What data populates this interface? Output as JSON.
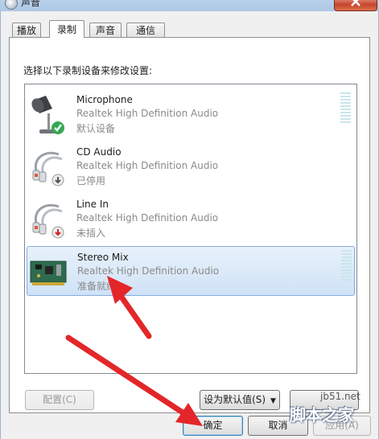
{
  "window": {
    "title": "声音",
    "icon": "speaker-icon",
    "close_icon": "close-icon"
  },
  "tabs": [
    {
      "label": "播放",
      "active": false
    },
    {
      "label": "录制",
      "active": true
    },
    {
      "label": "声音",
      "active": false
    },
    {
      "label": "通信",
      "active": false
    }
  ],
  "instruction": "选择以下录制设备来修改设置:",
  "devices": [
    {
      "name": "Microphone",
      "driver": "Realtek High Definition Audio",
      "status": "默认设备",
      "icon": "microphone-icon",
      "badge": "green-check-icon",
      "selected": false
    },
    {
      "name": "CD Audio",
      "driver": "Realtek High Definition Audio",
      "status": "已停用",
      "icon": "audio-cable-icon",
      "badge": "grey-down-arrow-icon",
      "selected": false
    },
    {
      "name": "Line In",
      "driver": "Realtek High Definition Audio",
      "status": "未插入",
      "icon": "audio-cable-icon",
      "badge": "red-down-arrow-icon",
      "selected": false
    },
    {
      "name": "Stereo Mix",
      "driver": "Realtek High Definition Audio",
      "status": "准备就绪",
      "icon": "sound-card-icon",
      "badge": "",
      "selected": true
    }
  ],
  "buttons": {
    "configure": "配置(C)",
    "set_default": "设为默认值(S)",
    "ok": "确定",
    "cancel": "取消",
    "apply": "应用(A)"
  },
  "watermark": {
    "site": "jb51.net",
    "name": "脚本之家"
  },
  "colors": {
    "annotation_arrow": "#e3262a",
    "selection": "#cfe2f6",
    "status_green": "#2f9e2f"
  }
}
